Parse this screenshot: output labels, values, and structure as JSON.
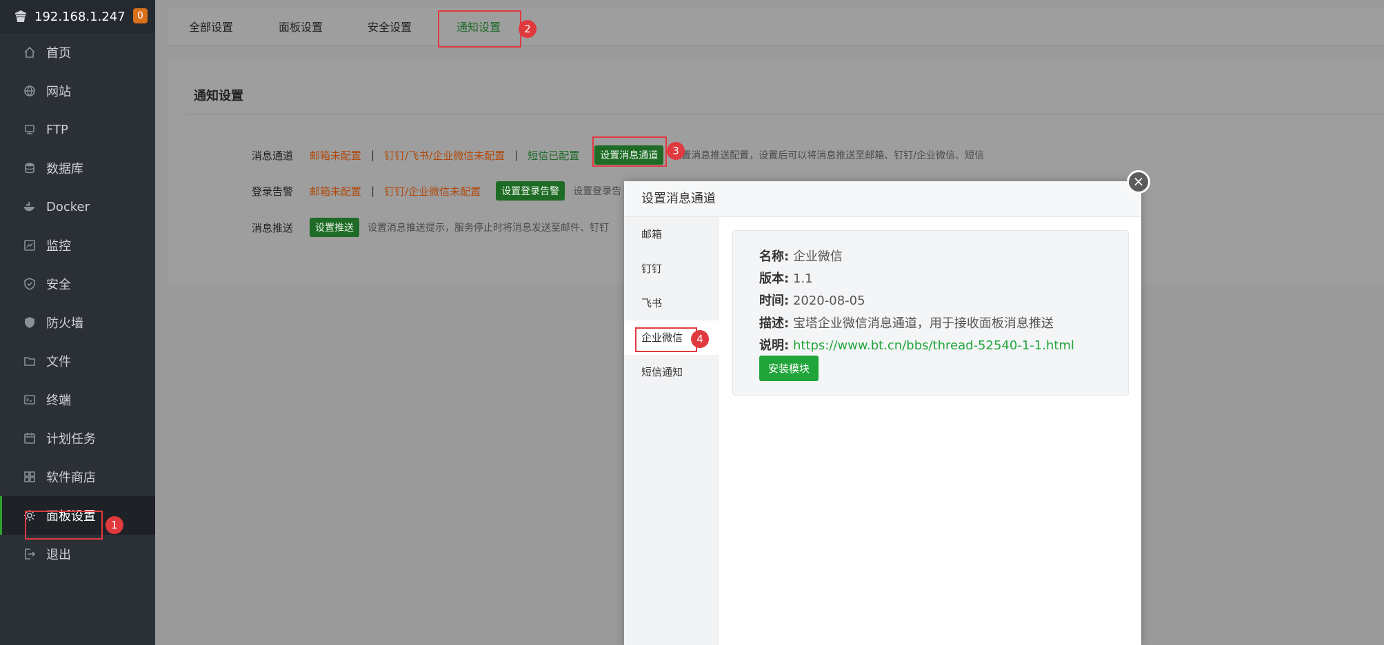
{
  "brand": {
    "ip": "192.168.1.247",
    "badge": "0"
  },
  "sidebar": {
    "items": [
      {
        "label": "首页",
        "icon": "home-icon"
      },
      {
        "label": "网站",
        "icon": "globe-icon"
      },
      {
        "label": "FTP",
        "icon": "ftp-icon"
      },
      {
        "label": "数据库",
        "icon": "database-icon"
      },
      {
        "label": "Docker",
        "icon": "docker-icon"
      },
      {
        "label": "监控",
        "icon": "monitor-icon"
      },
      {
        "label": "安全",
        "icon": "shield-icon"
      },
      {
        "label": "防火墙",
        "icon": "firewall-icon"
      },
      {
        "label": "文件",
        "icon": "folder-icon"
      },
      {
        "label": "终端",
        "icon": "terminal-icon"
      },
      {
        "label": "计划任务",
        "icon": "calendar-icon"
      },
      {
        "label": "软件商店",
        "icon": "grid-icon"
      },
      {
        "label": "面板设置",
        "icon": "gear-icon"
      },
      {
        "label": "退出",
        "icon": "logout-icon"
      }
    ]
  },
  "tabs": [
    "全部设置",
    "面板设置",
    "安全设置",
    "通知设置"
  ],
  "panel": {
    "title": "通知设置",
    "row1": {
      "label": "消息通道",
      "mail": "邮箱未配置",
      "sep": "|",
      "dingtalk": "钉钉/飞书/企业微信未配置",
      "sms": "短信已配置",
      "button": "设置消息通道",
      "hint": "设置消息推送配置，设置后可以将消息推送至邮箱、钉钉/企业微信、短信"
    },
    "row2": {
      "label": "登录告警",
      "mail": "邮箱未配置",
      "sep": "|",
      "dingtalk": "钉钉/企业微信未配置",
      "button": "设置登录告警",
      "hint": "设置登录告"
    },
    "row3": {
      "label": "消息推送",
      "button": "设置推送",
      "hint": "设置消息推送提示，服务停止时将消息发送至邮件、钉钉"
    }
  },
  "modal": {
    "title": "设置消息通道",
    "menu": [
      "邮箱",
      "钉钉",
      "飞书",
      "企业微信",
      "短信通知"
    ],
    "active_menu": "企业微信",
    "info": {
      "name_label": "名称:",
      "name": "企业微信",
      "version_label": "版本:",
      "version": "1.1",
      "time_label": "时间:",
      "time": "2020-08-05",
      "desc_label": "描述:",
      "desc": "宝塔企业微信消息通道，用于接收面板消息推送",
      "note_label": "说明:",
      "link": "https://www.bt.cn/bbs/thread-52540-1-1.html"
    },
    "install_button": "安装模块",
    "close": "×"
  },
  "annotations": [
    "1",
    "2",
    "3",
    "4"
  ],
  "colors": {
    "accent_green": "#20a53a",
    "annotation_red": "#e0393e",
    "warn_orange": "#d9701a"
  }
}
